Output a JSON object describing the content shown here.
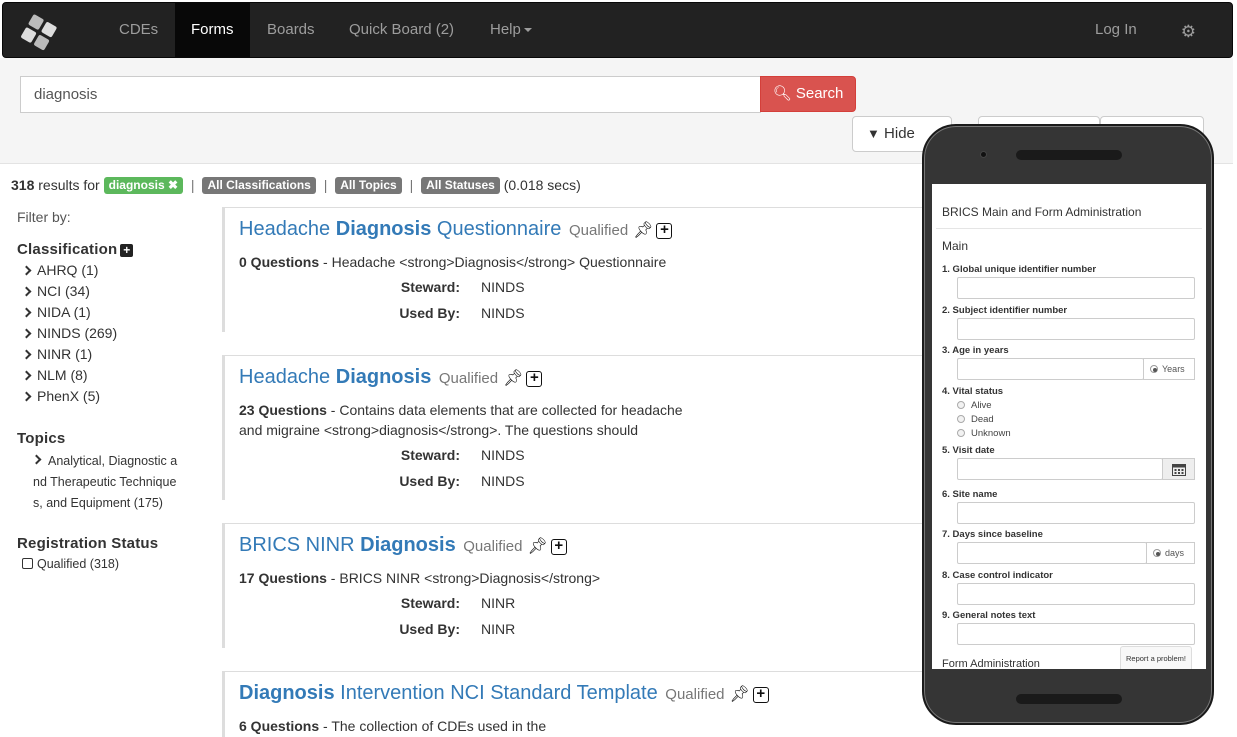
{
  "nav": {
    "items": [
      "CDEs",
      "Forms",
      "Boards",
      "Quick Board (2)",
      "Help"
    ],
    "login": "Log In"
  },
  "search": {
    "query": "diagnosis",
    "button": "Search",
    "hide_button": "Hide"
  },
  "results": {
    "count": "318",
    "results_for": "results for",
    "tag": "diagnosis",
    "filters": [
      "All Classifications",
      "All Topics",
      "All Statuses"
    ],
    "time": "(0.018 secs)"
  },
  "sidebar": {
    "filter_by": "Filter by:",
    "classification_head": "Classification",
    "classifications": [
      "AHRQ (1)",
      "NCI (34)",
      "NIDA (1)",
      "NINDS (269)",
      "NINR (1)",
      "NLM (8)",
      "PhenX (5)"
    ],
    "topics_head": "Topics",
    "topic_item": "Analytical, Diagnostic a nd Therapeutic Technique s, and Equipment (175)",
    "status_head": "Registration Status",
    "status_item": "Qualified (318)"
  },
  "cards": [
    {
      "title_pre": "Headache ",
      "title_bold": "Diagnosis",
      "title_post": " Questionnaire",
      "status": "Qualified",
      "questions": "0 Questions",
      "desc": " - Headache <strong>Diagnosis</strong> Questionnaire",
      "steward_label": "Steward:",
      "steward": "NINDS",
      "used_label": "Used By:",
      "used": "NINDS"
    },
    {
      "title_pre": "Headache ",
      "title_bold": "Diagnosis",
      "title_post": "",
      "status": "Qualified",
      "questions": "23 Questions",
      "desc": " - Contains data elements that are collected for headache and migraine <strong>diagnosis</strong>. The questions should",
      "steward_label": "Steward:",
      "steward": "NINDS",
      "used_label": "Used By:",
      "used": "NINDS"
    },
    {
      "title_pre": "BRICS NINR ",
      "title_bold": "Diagnosis",
      "title_post": "",
      "status": "Qualified",
      "questions": "17 Questions",
      "desc": " - BRICS NINR <strong>Diagnosis</strong>",
      "steward_label": "Steward:",
      "steward": "NINR",
      "used_label": "Used By:",
      "used": "NINR"
    },
    {
      "title_pre": "",
      "title_bold": "Diagnosis",
      "title_post": " Intervention NCI Standard Template",
      "status": "Qualified",
      "questions": "6 Questions",
      "desc": " - The collection of CDEs used in the"
    }
  ],
  "phone": {
    "form_title": "BRICS Main and Form Administration",
    "section": "Main",
    "questions": [
      "1. Global unique identifier number",
      "2. Subject identifier number",
      "3. Age in years",
      "4. Vital status",
      "5. Visit date",
      "6. Site name",
      "7. Days since baseline",
      "8. Case control indicator",
      "9. General notes text"
    ],
    "age_unit": "Years",
    "days_unit": "days",
    "vital_options": [
      "Alive",
      "Dead",
      "Unknown"
    ],
    "footer_section": "Form Administration",
    "report": "Report a problem!"
  }
}
